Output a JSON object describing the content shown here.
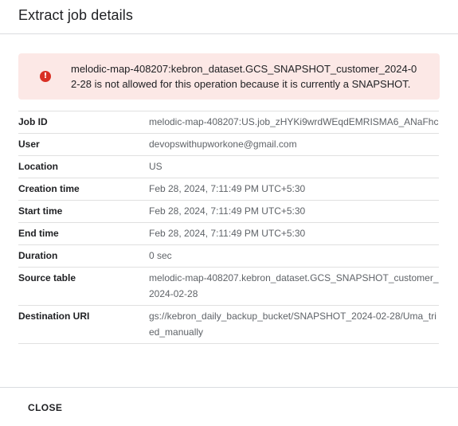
{
  "dialog": {
    "title": "Extract job details"
  },
  "error": {
    "icon": "error-icon",
    "icon_glyph": "!",
    "color": "#d93025",
    "background": "#fce8e6",
    "message": "melodic-map-408207:kebron_dataset.GCS_SNAPSHOT_customer_2024-02-28 is not allowed for this operation because it is currently a SNAPSHOT."
  },
  "details": [
    {
      "label": "Job ID",
      "value": "melodic-map-408207:US.job_zHYKi9wrdWEqdEMRISMA6_ANaFhc"
    },
    {
      "label": "User",
      "value": "devopswithupworkone@gmail.com"
    },
    {
      "label": "Location",
      "value": "US"
    },
    {
      "label": "Creation time",
      "value": "Feb 28, 2024, 7:11:49 PM UTC+5:30"
    },
    {
      "label": "Start time",
      "value": "Feb 28, 2024, 7:11:49 PM UTC+5:30"
    },
    {
      "label": "End time",
      "value": "Feb 28, 2024, 7:11:49 PM UTC+5:30"
    },
    {
      "label": "Duration",
      "value": "0 sec"
    },
    {
      "label": "Source table",
      "value": "melodic-map-408207.kebron_dataset.GCS_SNAPSHOT_customer_2024-02-28"
    },
    {
      "label": "Destination URI",
      "value": "gs://kebron_daily_backup_bucket/SNAPSHOT_2024-02-28/Uma_tried_manually"
    }
  ],
  "footer": {
    "close_label": "CLOSE"
  }
}
